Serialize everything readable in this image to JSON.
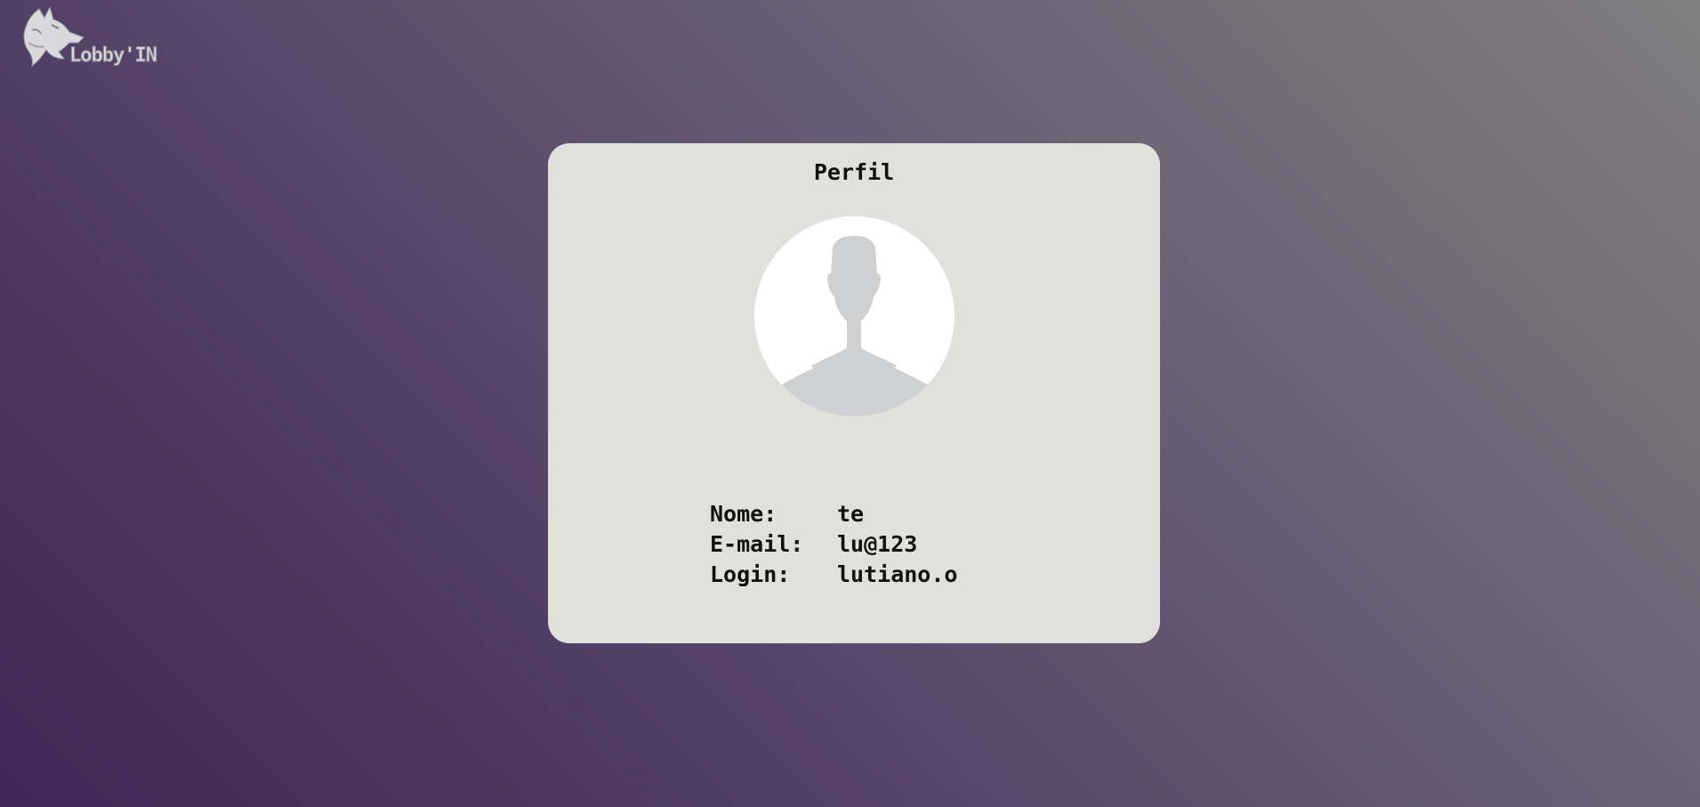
{
  "app": {
    "logo_text": "Lobby'IN",
    "logo_icon": "wolf-icon"
  },
  "profile": {
    "title": "Perfil",
    "avatar_icon": "user-silhouette-icon",
    "fields": [
      {
        "label": "Nome:",
        "value": "te"
      },
      {
        "label": "E-mail:",
        "value": "lu@123"
      },
      {
        "label": "Login:",
        "value": "lutiano.o"
      }
    ]
  },
  "colors": {
    "card_background": "#e0e0dd",
    "avatar_background": "#ffffff",
    "avatar_silhouette": "#cfd0d2",
    "text": "#111111"
  }
}
